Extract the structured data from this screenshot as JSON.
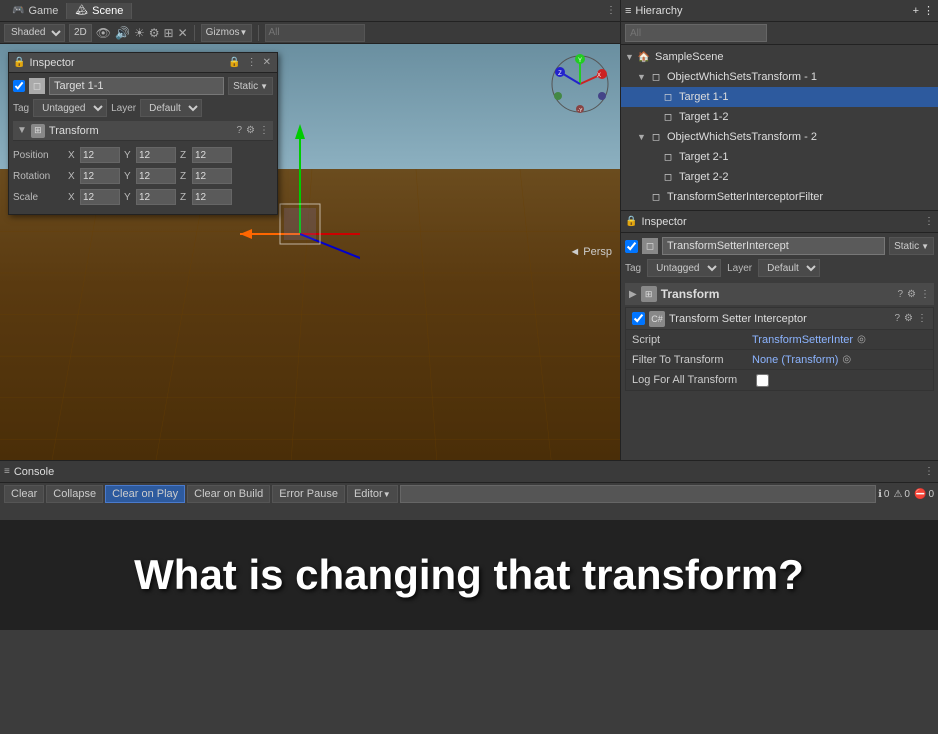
{
  "tabs": {
    "game_label": "Game",
    "scene_label": "Scene"
  },
  "scene_toolbar": {
    "shading": "Shaded",
    "view_2d": "2D",
    "gizmos_label": "Gizmos",
    "search_placeholder": "All"
  },
  "scene_view": {
    "persp_label": "◄ Persp"
  },
  "inspector_overlay": {
    "title": "Inspector",
    "object_name": "Target 1-1",
    "static_label": "Static",
    "tag_label": "Tag",
    "tag_value": "Untagged",
    "layer_label": "Layer",
    "layer_value": "Default",
    "transform_label": "Transform",
    "position_label": "Position",
    "rotation_label": "Rotation",
    "scale_label": "Scale",
    "x_label": "X",
    "y_label": "Y",
    "z_label": "Z",
    "pos_x": "12",
    "pos_y": "12",
    "pos_z": "12",
    "rot_x": "12",
    "rot_y": "12",
    "rot_z": "12",
    "scale_x": "12",
    "scale_y": "12",
    "scale_z": "12"
  },
  "hierarchy": {
    "title": "Hierarchy",
    "search_placeholder": "All",
    "items": [
      {
        "label": "SampleScene",
        "indent": 0,
        "expanded": true,
        "is_scene": true
      },
      {
        "label": "ObjectWhichSetsTransform - 1",
        "indent": 1,
        "expanded": true
      },
      {
        "label": "Target 1-1",
        "indent": 2,
        "expanded": false,
        "selected": true
      },
      {
        "label": "Target 1-2",
        "indent": 2,
        "expanded": false
      },
      {
        "label": "ObjectWhichSetsTransform - 2",
        "indent": 1,
        "expanded": true
      },
      {
        "label": "Target 2-1",
        "indent": 2,
        "expanded": false
      },
      {
        "label": "Target 2-2",
        "indent": 2,
        "expanded": false
      },
      {
        "label": "TransformSetterInterceptorFilter",
        "indent": 1,
        "expanded": false
      }
    ]
  },
  "right_inspector": {
    "title": "Inspector",
    "object_name": "TransformSetterIntercept",
    "static_label": "Static",
    "tag_label": "Tag",
    "tag_value": "Untagged",
    "layer_label": "Layer",
    "layer_value": "Default",
    "transform_section": "Transform",
    "script_section": "Transform Setter Interceptor",
    "script_label": "Script",
    "script_value": "TransformSetterInter",
    "filter_label": "Filter To Transform",
    "filter_value": "None (Transform)",
    "log_label": "Log For All Transform"
  },
  "console": {
    "title": "Console",
    "clear_label": "Clear",
    "collapse_label": "Collapse",
    "clear_on_play_label": "Clear on Play",
    "clear_on_build_label": "Clear on Build",
    "error_pause_label": "Error Pause",
    "editor_label": "Editor",
    "search_placeholder": "",
    "info_count": "0",
    "warn_count": "0",
    "error_count": "0"
  },
  "bottom_text": "What is changing that transform?"
}
